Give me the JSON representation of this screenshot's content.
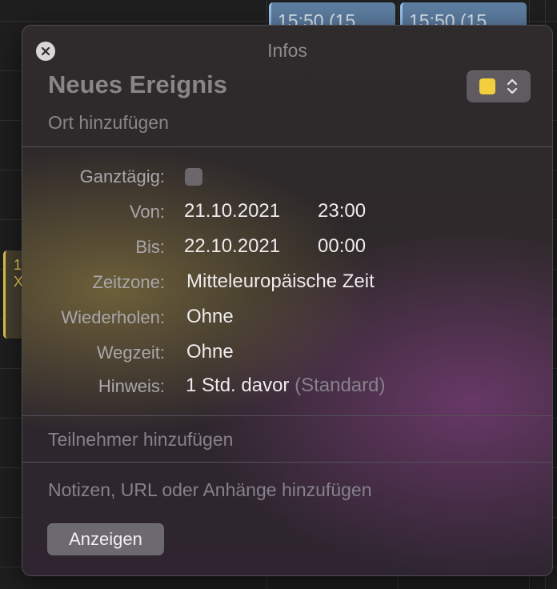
{
  "background": {
    "events": [
      {
        "label": "15:50 (15"
      },
      {
        "label": "15:50 (15"
      }
    ],
    "side_event": {
      "line1": "1",
      "line2": "X"
    }
  },
  "popover": {
    "window_title": "Infos",
    "event_title": "Neues Ereignis",
    "location_placeholder": "Ort hinzufügen",
    "color": "#f2cf3c",
    "fields": {
      "all_day_label": "Ganztägig:",
      "all_day_checked": false,
      "from_label": "Von:",
      "from_date": "21.10.2021",
      "from_time": "23:00",
      "to_label": "Bis:",
      "to_date": "22.10.2021",
      "to_time": "00:00",
      "timezone_label": "Zeitzone:",
      "timezone_value": "Mitteleuropäische Zeit",
      "repeat_label": "Wiederholen:",
      "repeat_value": "Ohne",
      "travel_label": "Wegzeit:",
      "travel_value": "Ohne",
      "alert_label": "Hinweis:",
      "alert_value": "1 Std. davor",
      "alert_default": "(Standard)"
    },
    "invitees_placeholder": "Teilnehmer hinzufügen",
    "notes_placeholder": "Notizen, URL oder Anhänge hinzufügen",
    "show_button": "Anzeigen"
  }
}
